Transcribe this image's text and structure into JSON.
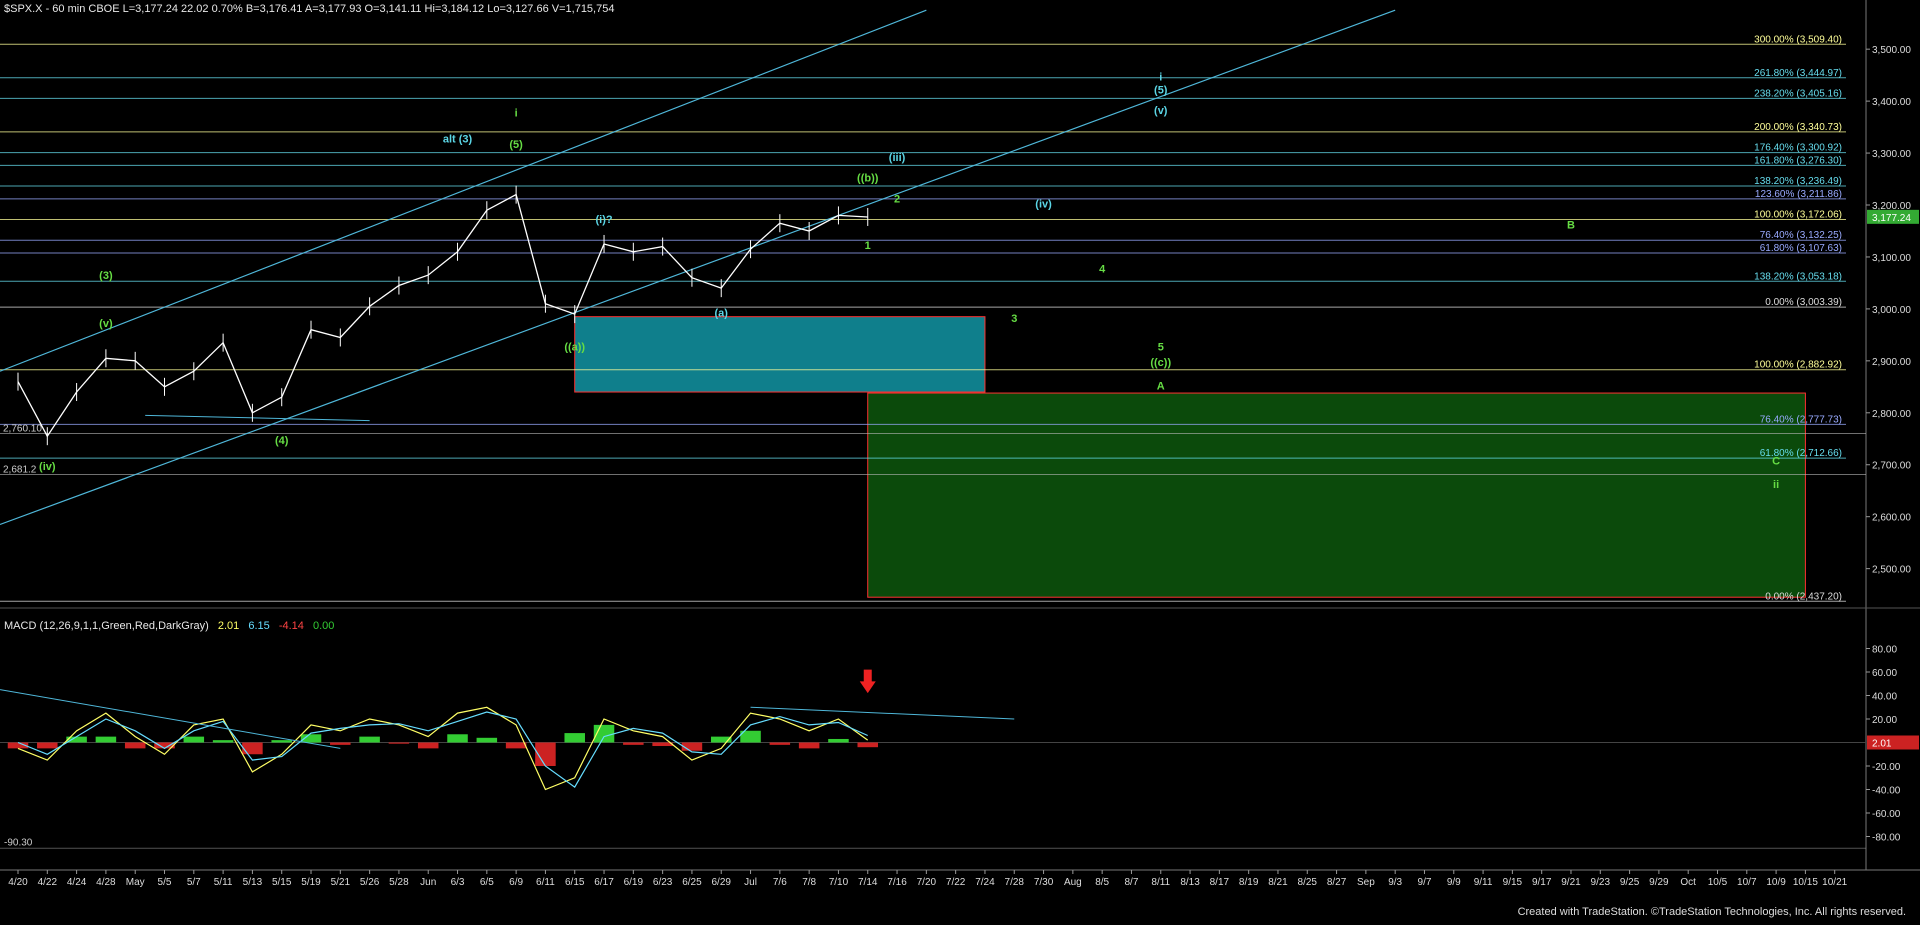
{
  "header": {
    "symbol_line": "$SPX.X - 60 min  CBOE  L=3,177.24  22.02  0.70%  B=3,176.41  A=3,177.93  O=3,141.11  Hi=3,184.12  Lo=3,127.66  V=1,715,754"
  },
  "macd_header": {
    "label": "MACD (12,26,9,1,1,Green,Red,DarkGray)",
    "v1": "2.01",
    "v2": "6.15",
    "v3": "-4.14",
    "v4": "0.00"
  },
  "footer": {
    "credit": "Created with TradeStation. ©TradeStation Technologies, Inc. All rights reserved."
  },
  "colors": {
    "background": "#000000",
    "price_bar": "#ffffff",
    "wave_label": "#66dd44",
    "wave_label_cyan": "#5bd6e6",
    "fib_yellow": "#ffff99",
    "fib_blue": "#99aaff",
    "fib_cyan": "#66ddee",
    "fib_white": "#dddddd",
    "box_teal": "#0f7f8c",
    "box_green": "#0b4a0b",
    "box_border": "#ff3333",
    "macd_pos": "#33cc33",
    "macd_neg": "#cc2222",
    "macd_line1": "#ffff66",
    "macd_line2": "#66ddff",
    "trendline": "#4fb7d9",
    "last_price_box": "#33aa33"
  },
  "chart_data": {
    "type": "line",
    "title": "$SPX.X - 60 min",
    "ylim": [
      2430,
      3560
    ],
    "y_ticks": [
      2500,
      2600,
      2700,
      2800,
      2900,
      3000,
      3100,
      3200,
      3300,
      3400,
      3500
    ],
    "y_tick_labels": [
      "2,500.00",
      "2,600.00",
      "2,700.00",
      "2,800.00",
      "2,900.00",
      "3,000.00",
      "3,100.00",
      "3,200.00",
      "3,300.00",
      "3,400.00",
      "3,500.00"
    ],
    "last_price": 3177.24,
    "last_price_label": "3,177.24",
    "x_ticks": [
      "4/20",
      "4/22",
      "4/24",
      "4/28",
      "May",
      "5/5",
      "5/7",
      "5/11",
      "5/13",
      "5/15",
      "5/19",
      "5/21",
      "5/26",
      "5/28",
      "Jun",
      "6/3",
      "6/5",
      "6/9",
      "6/11",
      "6/15",
      "6/17",
      "6/19",
      "6/23",
      "6/25",
      "6/29",
      "Jul",
      "7/6",
      "7/8",
      "7/10",
      "7/14",
      "7/16",
      "7/20",
      "7/22",
      "7/24",
      "7/28",
      "7/30",
      "Aug",
      "8/5",
      "8/7",
      "8/11",
      "8/13",
      "8/17",
      "8/19",
      "8/21",
      "8/25",
      "8/27",
      "Sep",
      "9/3",
      "9/7",
      "9/9",
      "9/11",
      "9/15",
      "9/17",
      "9/21",
      "9/23",
      "9/25",
      "9/29",
      "Oct",
      "10/5",
      "10/7",
      "10/9",
      "10/15",
      "10/21"
    ],
    "price_series": {
      "name": "$SPX.X",
      "points": [
        [
          "4/20",
          2860
        ],
        [
          "4/22",
          2755
        ],
        [
          "4/24",
          2840
        ],
        [
          "4/28",
          2905
        ],
        [
          "May",
          2900
        ],
        [
          "5/5",
          2850
        ],
        [
          "5/7",
          2880
        ],
        [
          "5/11",
          2935
        ],
        [
          "5/13",
          2800
        ],
        [
          "5/15",
          2830
        ],
        [
          "5/19",
          2960
        ],
        [
          "5/21",
          2945
        ],
        [
          "5/26",
          3005
        ],
        [
          "5/28",
          3045
        ],
        [
          "Jun",
          3065
        ],
        [
          "6/3",
          3110
        ],
        [
          "6/5",
          3190
        ],
        [
          "6/9",
          3220
        ],
        [
          "6/11",
          3010
        ],
        [
          "6/15",
          2990
        ],
        [
          "6/17",
          3125
        ],
        [
          "6/19",
          3110
        ],
        [
          "6/23",
          3120
        ],
        [
          "6/25",
          3060
        ],
        [
          "6/29",
          3040
        ],
        [
          "Jul",
          3115
        ],
        [
          "7/6",
          3165
        ],
        [
          "7/8",
          3150
        ],
        [
          "7/10",
          3180
        ],
        [
          "7/14",
          3177
        ]
      ]
    },
    "fib_levels": [
      {
        "label": "300.00% (3,509.40)",
        "value": 3509.4,
        "color": "fib_yellow"
      },
      {
        "label": "261.80% (3,444.97)",
        "value": 3444.97,
        "color": "fib_cyan"
      },
      {
        "label": "238.20% (3,405.16)",
        "value": 3405.16,
        "color": "fib_cyan"
      },
      {
        "label": "200.00% (3,340.73)",
        "value": 3340.73,
        "color": "fib_yellow"
      },
      {
        "label": "176.40% (3,300.92)",
        "value": 3300.92,
        "color": "fib_cyan"
      },
      {
        "label": "161.80% (3,276.30)",
        "value": 3276.3,
        "color": "fib_cyan"
      },
      {
        "label": "138.20% (3,236.49)",
        "value": 3236.49,
        "color": "fib_cyan"
      },
      {
        "label": "123.60% (3,211.86)",
        "value": 3211.86,
        "color": "fib_blue"
      },
      {
        "label": "100.00% (3,172.06)",
        "value": 3172.06,
        "color": "fib_yellow"
      },
      {
        "label": "76.40% (3,132.25)",
        "value": 3132.25,
        "color": "fib_blue"
      },
      {
        "label": "61.80% (3,107.63)",
        "value": 3107.63,
        "color": "fib_blue"
      },
      {
        "label": "138.20% (3,053.18)",
        "value": 3053.18,
        "color": "fib_cyan"
      },
      {
        "label": "0.00% (3,003.39)",
        "value": 3003.39,
        "color": "fib_white"
      },
      {
        "label": "100.00% (2,882.92)",
        "value": 2882.92,
        "color": "fib_yellow"
      },
      {
        "label": "76.40% (2,777.73)",
        "value": 2777.73,
        "color": "fib_blue"
      },
      {
        "label": "61.80% (2,712.66)",
        "value": 2712.66,
        "color": "fib_cyan"
      },
      {
        "label": "0.00% (2,437.20)",
        "value": 2437.2,
        "color": "fib_white"
      }
    ],
    "extra_levels": [
      {
        "label": "2,760.10",
        "value": 2760.1
      },
      {
        "label": "2,681.2",
        "value": 2681.2
      }
    ],
    "zones": [
      {
        "name": "teal-support-box",
        "x_from": "6/15",
        "x_to": "7/24",
        "y_from": 2840,
        "y_to": 2985,
        "color": "box_teal"
      },
      {
        "name": "green-target-box",
        "x_from": "7/14",
        "x_to": "10/15",
        "y_from": 2445,
        "y_to": 2838,
        "color": "box_green"
      }
    ],
    "wave_labels": [
      {
        "text": "(3)",
        "x": "4/28",
        "y": 3058,
        "color": "wave_label"
      },
      {
        "text": "(v)",
        "x": "4/28",
        "y": 2965,
        "color": "wave_label"
      },
      {
        "text": "(iv)",
        "x": "4/22",
        "y": 2690,
        "color": "wave_label"
      },
      {
        "text": "(4)",
        "x": "5/15",
        "y": 2740,
        "color": "wave_label"
      },
      {
        "text": "alt (3)",
        "x": "6/3",
        "y": 3320,
        "color": "wave_label_cyan"
      },
      {
        "text": "(5)",
        "x": "6/9",
        "y": 3310,
        "color": "wave_label"
      },
      {
        "text": "i",
        "x": "6/9",
        "y": 3370,
        "color": "wave_label"
      },
      {
        "text": "(i)?",
        "x": "6/17",
        "y": 3165,
        "color": "wave_label_cyan"
      },
      {
        "text": "((a))",
        "x": "6/15",
        "y": 2920,
        "color": "wave_label"
      },
      {
        "text": "(a)",
        "x": "6/29",
        "y": 2985,
        "color": "wave_label_cyan"
      },
      {
        "text": "((b))",
        "x": "7/14",
        "y": 3245,
        "color": "wave_label"
      },
      {
        "text": "(iii)",
        "x": "7/16",
        "y": 3285,
        "color": "wave_label_cyan"
      },
      {
        "text": "2",
        "x": "7/16",
        "y": 3205,
        "color": "wave_label"
      },
      {
        "text": "1",
        "x": "7/14",
        "y": 3115,
        "color": "wave_label"
      },
      {
        "text": "(iv)",
        "x": "7/30",
        "y": 3195,
        "color": "wave_label_cyan"
      },
      {
        "text": "i",
        "x": "8/11",
        "y": 3440,
        "color": "wave_label_cyan"
      },
      {
        "text": "(5)",
        "x": "8/11",
        "y": 3415,
        "color": "wave_label_cyan"
      },
      {
        "text": "(v)",
        "x": "8/11",
        "y": 3375,
        "color": "wave_label_cyan"
      },
      {
        "text": "4",
        "x": "8/5",
        "y": 3070,
        "color": "wave_label"
      },
      {
        "text": "3",
        "x": "7/28",
        "y": 2975,
        "color": "wave_label"
      },
      {
        "text": "5",
        "x": "8/11",
        "y": 2920,
        "color": "wave_label"
      },
      {
        "text": "((c))",
        "x": "8/11",
        "y": 2890,
        "color": "wave_label"
      },
      {
        "text": "A",
        "x": "8/11",
        "y": 2845,
        "color": "wave_label"
      },
      {
        "text": "B",
        "x": "9/21",
        "y": 3155,
        "color": "wave_label"
      },
      {
        "text": "C",
        "x": "10/9",
        "y": 2700,
        "color": "wave_label"
      },
      {
        "text": "ii",
        "x": "10/9",
        "y": 2655,
        "color": "wave_label"
      }
    ],
    "macd": {
      "ylim": [
        -100,
        100
      ],
      "y_ticks": [
        -80,
        -60,
        -40,
        -20,
        20,
        40,
        60,
        80
      ],
      "y_tick_labels": [
        "-80.00",
        "-60.00",
        "-40.00",
        "-20.00",
        "20.00",
        "40.00",
        "60.00",
        "80.00"
      ],
      "min_label": "-90.30",
      "current_label": "2.01",
      "line1": [
        [
          "4/20",
          -5
        ],
        [
          "4/22",
          -15
        ],
        [
          "4/24",
          10
        ],
        [
          "4/28",
          25
        ],
        [
          "May",
          5
        ],
        [
          "5/5",
          -10
        ],
        [
          "5/7",
          15
        ],
        [
          "5/11",
          20
        ],
        [
          "5/13",
          -25
        ],
        [
          "5/15",
          -10
        ],
        [
          "5/19",
          15
        ],
        [
          "5/21",
          10
        ],
        [
          "5/26",
          20
        ],
        [
          "5/28",
          15
        ],
        [
          "Jun",
          5
        ],
        [
          "6/3",
          25
        ],
        [
          "6/5",
          30
        ],
        [
          "6/9",
          15
        ],
        [
          "6/11",
          -40
        ],
        [
          "6/15",
          -30
        ],
        [
          "6/17",
          20
        ],
        [
          "6/19",
          10
        ],
        [
          "6/23",
          5
        ],
        [
          "6/25",
          -15
        ],
        [
          "6/29",
          -5
        ],
        [
          "Jul",
          25
        ],
        [
          "7/6",
          20
        ],
        [
          "7/8",
          10
        ],
        [
          "7/10",
          20
        ],
        [
          "7/14",
          2
        ]
      ],
      "line2": [
        [
          "4/20",
          0
        ],
        [
          "4/22",
          -10
        ],
        [
          "4/24",
          5
        ],
        [
          "4/28",
          20
        ],
        [
          "May",
          10
        ],
        [
          "5/5",
          -5
        ],
        [
          "5/7",
          10
        ],
        [
          "5/11",
          18
        ],
        [
          "5/13",
          -15
        ],
        [
          "5/15",
          -12
        ],
        [
          "5/19",
          8
        ],
        [
          "5/21",
          12
        ],
        [
          "5/26",
          15
        ],
        [
          "5/28",
          16
        ],
        [
          "Jun",
          10
        ],
        [
          "6/3",
          18
        ],
        [
          "6/5",
          26
        ],
        [
          "6/9",
          20
        ],
        [
          "6/11",
          -20
        ],
        [
          "6/15",
          -38
        ],
        [
          "6/17",
          5
        ],
        [
          "6/19",
          12
        ],
        [
          "6/23",
          8
        ],
        [
          "6/25",
          -8
        ],
        [
          "6/29",
          -10
        ],
        [
          "Jul",
          15
        ],
        [
          "7/6",
          22
        ],
        [
          "7/8",
          15
        ],
        [
          "7/10",
          17
        ],
        [
          "7/14",
          6
        ]
      ],
      "hist": [
        [
          "4/20",
          -5
        ],
        [
          "4/22",
          -5
        ],
        [
          "4/24",
          5
        ],
        [
          "4/28",
          5
        ],
        [
          "May",
          -5
        ],
        [
          "5/5",
          -5
        ],
        [
          "5/7",
          5
        ],
        [
          "5/11",
          2
        ],
        [
          "5/13",
          -10
        ],
        [
          "5/15",
          2
        ],
        [
          "5/19",
          7
        ],
        [
          "5/21",
          -2
        ],
        [
          "5/26",
          5
        ],
        [
          "5/28",
          -1
        ],
        [
          "Jun",
          -5
        ],
        [
          "6/3",
          7
        ],
        [
          "6/5",
          4
        ],
        [
          "6/9",
          -5
        ],
        [
          "6/11",
          -20
        ],
        [
          "6/15",
          8
        ],
        [
          "6/17",
          15
        ],
        [
          "6/19",
          -2
        ],
        [
          "6/23",
          -3
        ],
        [
          "6/25",
          -7
        ],
        [
          "6/29",
          5
        ],
        [
          "Jul",
          10
        ],
        [
          "7/6",
          -2
        ],
        [
          "7/8",
          -5
        ],
        [
          "7/10",
          3
        ],
        [
          "7/14",
          -4
        ]
      ]
    }
  }
}
